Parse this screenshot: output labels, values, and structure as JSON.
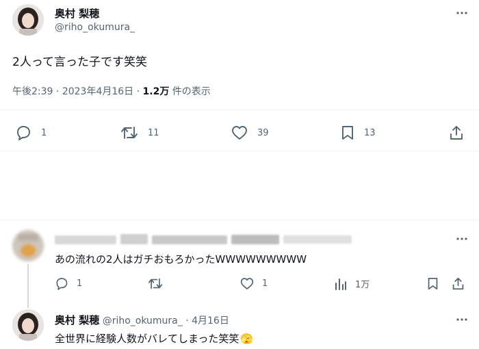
{
  "tweet": {
    "author_name": "奥村 梨穂",
    "author_handle": "@riho_okumura_",
    "text": "2人って言った子です笑笑",
    "time": "午後2:39",
    "sep": "·",
    "date": "2023年4月16日",
    "views_count": "1.2万",
    "views_label": "件の表示",
    "replies": "1",
    "retweets": "11",
    "likes": "39",
    "bookmarks": "13"
  },
  "reply1": {
    "text": "あの流れの2人はガチおもろかったWWWWWWWWW",
    "replies": "1",
    "likes": "1",
    "views": "1万"
  },
  "reply2": {
    "author_name": "奥村 梨穂",
    "author_handle": "@riho_okumura_",
    "sep": "·",
    "date": "4月16日",
    "text": "全世界に経験人数がバレてしまった笑笑",
    "emoji": "🫣"
  },
  "colors": {
    "text": "#0f1419",
    "secondary": "#536471",
    "divider": "#eff3f4"
  },
  "icons": [
    "more-horizontal-icon",
    "reply-icon",
    "retweet-icon",
    "like-icon",
    "bookmark-icon",
    "share-icon",
    "views-icon"
  ]
}
